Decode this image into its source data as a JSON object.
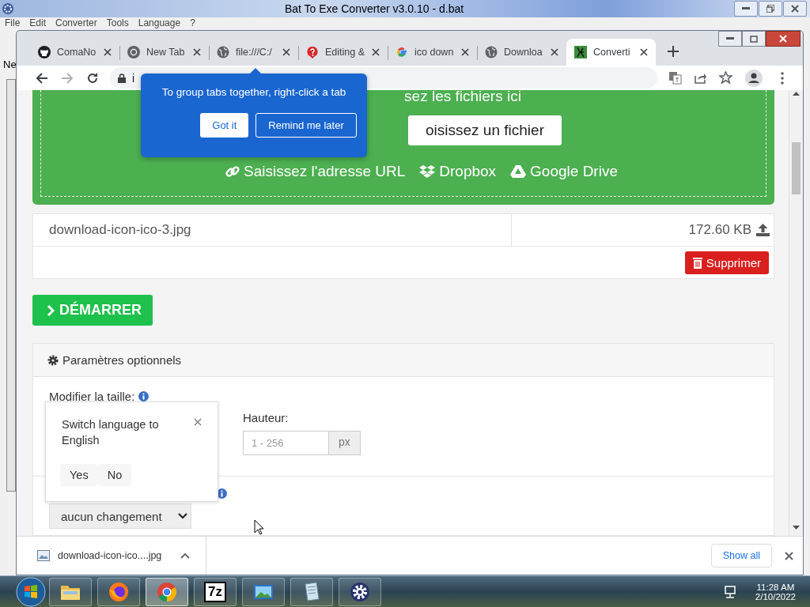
{
  "app_window": {
    "title": "Bat To Exe Converter v3.0.10 - d.bat",
    "menu": [
      "File",
      "Edit",
      "Converter",
      "Tools",
      "Language",
      "?"
    ],
    "side_label": "Ne"
  },
  "browser": {
    "tabs": [
      {
        "kind": "github",
        "label": "ComaNo",
        "selected": false
      },
      {
        "kind": "chrome",
        "label": "New Tab",
        "selected": false
      },
      {
        "kind": "globe",
        "label": "file:///C:/",
        "selected": false
      },
      {
        "kind": "pin",
        "label": "Editing &",
        "selected": false
      },
      {
        "kind": "google",
        "label": "ico down",
        "selected": false
      },
      {
        "kind": "globe",
        "label": "Downloa",
        "selected": false
      },
      {
        "kind": "converter",
        "label": "Converti",
        "selected": true
      }
    ],
    "address": "i"
  },
  "tab_group_tip": {
    "text": "To group tabs together, right-click a tab",
    "buttons": [
      "Got it",
      "Remind me later"
    ]
  },
  "dropzone": {
    "heading": "sez les fichiers ici",
    "choose_button": "oisissez un fichier",
    "sources": [
      {
        "kind": "link",
        "label": "Saisissez l'adresse URL"
      },
      {
        "kind": "dropbox",
        "label": "Dropbox"
      },
      {
        "kind": "drive",
        "label": "Google Drive"
      }
    ]
  },
  "file": {
    "name": "download-icon-ico-3.jpg",
    "size": "172.60 KB",
    "delete_button": "Supprimer"
  },
  "start_button": "DÉMARRER",
  "options": {
    "title": "Paramètres optionnels",
    "resize_label": "Modifier la taille:",
    "height_label": "Hauteur:",
    "height_field": {
      "placeholder": "1 - 256"
    },
    "unit": "px",
    "select_value": "aucun changement"
  },
  "language_prompt": {
    "text": "Switch language to English",
    "buttons": [
      "Yes",
      "No"
    ]
  },
  "downloads": {
    "file": "download-icon-ico....jpg",
    "show_all": "Show all"
  },
  "taskbar": {
    "apps": [
      {
        "kind": "folder",
        "selected": false
      },
      {
        "kind": "firefox",
        "selected": false
      },
      {
        "kind": "chrome",
        "selected": true
      },
      {
        "kind": "archive",
        "label": "7z",
        "selected": false
      },
      {
        "kind": "picture",
        "selected": false
      },
      {
        "kind": "notepad",
        "selected": false
      },
      {
        "kind": "gear",
        "selected": false
      }
    ],
    "time": "11:28 AM",
    "date": "2/10/2022"
  }
}
